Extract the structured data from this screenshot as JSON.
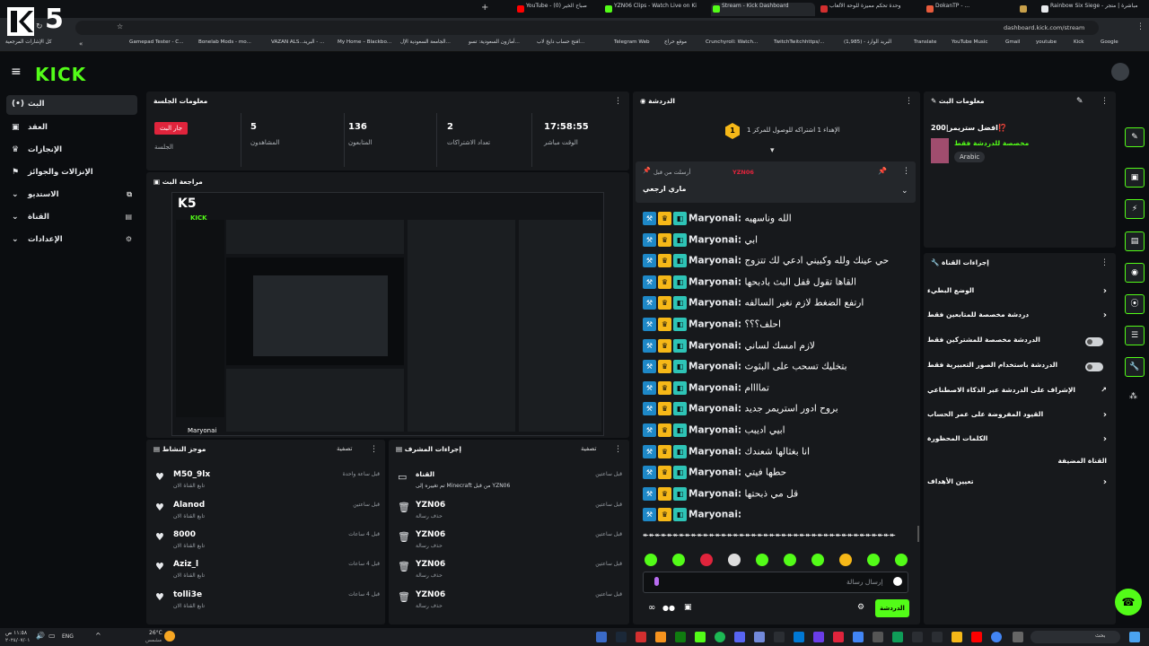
{
  "browser": {
    "tabs": [
      {
        "label": "Rainbow Six Siege - مباشرة | متجر",
        "color": "#e8eaed"
      },
      {
        "label": "سجل العمليات - ...",
        "color": "#c8a04a"
      },
      {
        "label": "DokanTP - ...",
        "color": "#e85b3c"
      },
      {
        "label": "وحدة تحكم مميزة للوحة الألعاب",
        "color": "#d32f2f"
      },
      {
        "label": "Stream - Kick Dashboard",
        "color": "#53fc18"
      },
      {
        "label": "YZN06 Clips - Watch Live on Ki",
        "color": "#53fc18"
      },
      {
        "label": "YouTube - صباح الخير (0)",
        "color": "#ff0000"
      }
    ],
    "url": "dashboard.kick.com/stream",
    "bookmarks": [
      "Gamepad Tester - C...",
      "Bonelab Mods - mo...",
      "VAZAN ALS...",
      "البريد - ...",
      "My Home – Blackbo...",
      "الجامعة السعودية الإل...",
      "أمازون السعودية: تسو...",
      "افتح حساب دايخ لاب...",
      "Telegram Web",
      "موقع حراج",
      "Crunchyroll: Watch...",
      "TwitchTwitchhttps/...",
      "(1,985) - البريد الوارد",
      "Translate",
      "YouTube Music",
      "Gmail",
      "youtube",
      "Kick",
      "Google",
      "كل الإشارات المرجعية"
    ]
  },
  "overlay": {
    "channel_mark": "5"
  },
  "brand": {
    "logo": "KICK",
    "accent": "#53fc18"
  },
  "sidebar": {
    "items": [
      {
        "label": "البث",
        "icon": "broadcast-icon"
      },
      {
        "label": "العقد",
        "icon": "contract-icon"
      },
      {
        "label": "الإنجازات",
        "icon": "trophy-icon"
      },
      {
        "label": "الإنزالات والجوائز",
        "icon": "gift-icon"
      },
      {
        "label": "الاستديو",
        "icon": "studio-icon"
      },
      {
        "label": "القناة",
        "icon": "channel-icon"
      },
      {
        "label": "الإعدادات",
        "icon": "gear-icon"
      }
    ]
  },
  "session": {
    "title": "معلومات الجلسة",
    "live_badge": "جار البث",
    "live_label": "الجلسة",
    "stats": [
      {
        "value": "5",
        "label": "المشاهدون"
      },
      {
        "value": "136",
        "label": "المتابعون"
      },
      {
        "value": "2",
        "label": "تعداد الاشتراكات"
      },
      {
        "value": "17:58:55",
        "label": "الوقت مباشر"
      }
    ]
  },
  "preview": {
    "title": "مراجعة البث",
    "overlay_user": "Maryonai"
  },
  "activity": {
    "title": "موجز النشاط",
    "filter": "تصفية",
    "items": [
      {
        "name": "M50_9lx",
        "sub": "تابع القناة الان",
        "time": "قبل ساعة واحدة"
      },
      {
        "name": "Alanod",
        "sub": "تابع القناة الان",
        "time": "قبل ساعتين"
      },
      {
        "name": "8000",
        "sub": "تابع القناة الان",
        "time": "قبل 4 ساعات"
      },
      {
        "name": "Aziz_l",
        "sub": "تابع القناة الان",
        "time": "قبل 4 ساعات"
      },
      {
        "name": "tolli3e",
        "sub": "تابع القناة الان",
        "time": "قبل 4 ساعات"
      }
    ]
  },
  "mod": {
    "title": "إجراءات المشرف",
    "filter": "تصفية",
    "items": [
      {
        "name": "القناة",
        "sub": "تم تغييره إلى Minecraft من قبل YZN06",
        "time": "قبل ساعتين"
      },
      {
        "name": "YZN06",
        "sub": "حذف رسالة",
        "time": "قبل ساعتين"
      },
      {
        "name": "YZN06",
        "sub": "حذف رسالة",
        "time": "قبل ساعتين"
      },
      {
        "name": "YZN06",
        "sub": "حذف رسالة",
        "time": "قبل ساعتين"
      },
      {
        "name": "YZN06",
        "sub": "حذف رسالة",
        "time": "قبل ساعتين"
      }
    ]
  },
  "chat": {
    "title": "الدردشة",
    "goal_text": "الإهداء 1 اشتراكه للوصول للمركز 1",
    "goal_rank": "1",
    "pinned_by": "أرسلت من قبل",
    "pinned_user": "YZN06",
    "pinned_text": "ماري ارجعي",
    "messages": [
      {
        "user": "Maryonai:",
        "text": "الله وناسهيه"
      },
      {
        "user": "Maryonai:",
        "text": "ابي"
      },
      {
        "user": "Maryonai:",
        "text": "حي عينك ولله وكبيني ادعي لك تتزوج"
      },
      {
        "user": "Maryonai:",
        "text": "القاها تقول قفل البث بادبحها"
      },
      {
        "user": "Maryonai:",
        "text": "ارتفع الضغط لازم نغير السالفه"
      },
      {
        "user": "Maryonai:",
        "text": "احلف؟؟؟"
      },
      {
        "user": "Maryonai:",
        "text": "لازم امسك لساني"
      },
      {
        "user": "Maryonai:",
        "text": "بتخليك تسحب على البثوث"
      },
      {
        "user": "Maryonai:",
        "text": "تماااام"
      },
      {
        "user": "Maryonai:",
        "text": "بروح ادور استريمر جديد"
      },
      {
        "user": "Maryonai:",
        "text": "ابيي اديبب"
      },
      {
        "user": "Maryonai:",
        "text": "انا بغثالها شعندك"
      },
      {
        "user": "Maryonai:",
        "text": "حطها فيتي"
      },
      {
        "user": "Maryonai:",
        "text": "قل مي ذبحتها"
      },
      {
        "user": "Maryonai:",
        "text": ""
      }
    ],
    "spam_line": "↞↞↞↞↞↞↞↞↞↞↞↞↞↞↞↞↞↞↞↞↞↞↞↞↞↞↞↞↞↞↞↞↞↞↞↞↞↞↞↞↞↞",
    "input_placeholder": "إرسال رسالة",
    "send_label": "الدردشة"
  },
  "stream_info": {
    "title": "معلومات البث",
    "stream_title": "افضل ستريمر|200⁉️",
    "category": "مخصصة للدردشة فقط",
    "language": "Arabic"
  },
  "channel_actions": {
    "title": "إجراءات القناة",
    "items": [
      {
        "label": "الوضع البطيء",
        "control": "chevron"
      },
      {
        "label": "دردشة مخصصة للمتابعين فقط",
        "control": "chevron"
      },
      {
        "label": "الدردشة مخصصة للمشتركين فقط",
        "control": "toggle"
      },
      {
        "label": "الدردشة باستخدام الصور التعبيرية فقط",
        "control": "toggle"
      },
      {
        "label": "الإشراف على الدردشة عبر الذكاء الاصطناعي",
        "control": "external"
      },
      {
        "label": "القيود المفروضة على عمر الحساب",
        "control": "chevron"
      },
      {
        "label": "الكلمات المحظورة",
        "control": "chevron"
      },
      {
        "label": "القناة المضيفة",
        "control": "none"
      },
      {
        "label": "تعيين الأهداف",
        "control": "chevron"
      }
    ]
  },
  "taskbar": {
    "weather": "26°C",
    "weather_sub": "مشمس",
    "lang": "ENG",
    "time": "١١:٥٨ ص",
    "date": "٢٠٢٤/٠٧/٠١",
    "search": "بحث"
  }
}
